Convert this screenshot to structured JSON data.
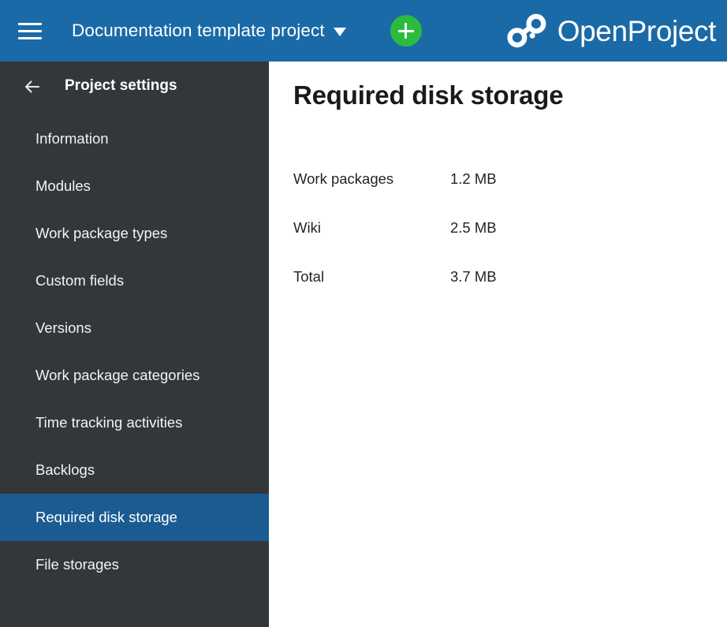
{
  "header": {
    "menu_icon": "hamburger-menu-icon",
    "project_name": "Documentation template project",
    "dropdown_icon": "chevron-down-icon",
    "add_icon": "plus-icon",
    "brand_name": "OpenProject",
    "brand_logo_icon": "openproject-logo-icon",
    "background_color": "#1a6aa8",
    "add_button_color": "#2cbb3f"
  },
  "sidebar": {
    "back_icon": "arrow-left-icon",
    "title": "Project settings",
    "background_color": "#333739",
    "active_color": "#1a5c92",
    "items": [
      {
        "label": "Information",
        "active": false
      },
      {
        "label": "Modules",
        "active": false
      },
      {
        "label": "Work package types",
        "active": false
      },
      {
        "label": "Custom fields",
        "active": false
      },
      {
        "label": "Versions",
        "active": false
      },
      {
        "label": "Work package categories",
        "active": false
      },
      {
        "label": "Time tracking activities",
        "active": false
      },
      {
        "label": "Backlogs",
        "active": false
      },
      {
        "label": "Required disk storage",
        "active": true
      },
      {
        "label": "File storages",
        "active": false
      }
    ]
  },
  "main": {
    "title": "Required disk storage",
    "rows": [
      {
        "label": "Work packages",
        "value": "1.2 MB"
      },
      {
        "label": "Wiki",
        "value": "2.5 MB"
      },
      {
        "label": "Total",
        "value": "3.7 MB"
      }
    ]
  }
}
